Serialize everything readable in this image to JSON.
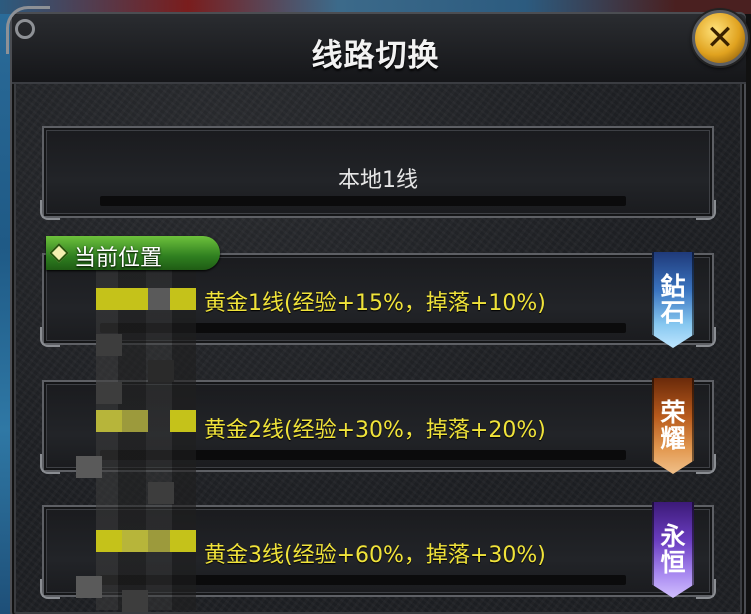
{
  "dialog": {
    "title": "线路切换",
    "close_icon": "close-x-icon"
  },
  "lines": {
    "local": {
      "label": "本地1线"
    },
    "current_marker": {
      "label": "当前位置"
    },
    "gold": [
      {
        "label": "黄金1线(经验+15%，掉落+10%)",
        "badge": [
          "鉆",
          "石"
        ],
        "badge_color": "#3a74c0"
      },
      {
        "label": "黄金2线(经验+30%，掉落+20%)",
        "badge": [
          "荣",
          "耀"
        ],
        "badge_color": "#b85a1c"
      },
      {
        "label": "黄金3线(经验+60%，掉落+30%)",
        "badge": [
          "永",
          "恒"
        ],
        "badge_color": "#6a3dc0"
      }
    ]
  },
  "colors": {
    "gold_text": "#f0e33a",
    "current_tag": "#3f9a25",
    "close_button": "#e0a21f"
  }
}
